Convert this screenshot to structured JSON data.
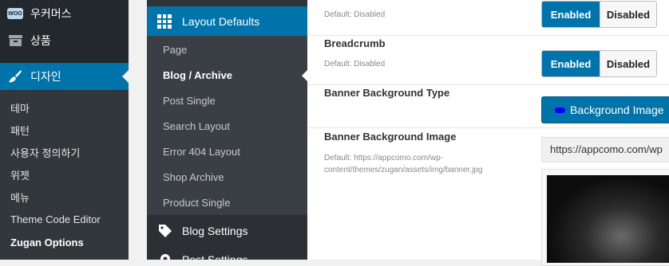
{
  "wp_sidebar": {
    "top_items": [
      {
        "label": "우커머스",
        "icon": "woo-icon",
        "badge": "WOO"
      },
      {
        "label": "상품",
        "icon": "archive-icon"
      },
      {
        "label": "디자인",
        "icon": "paintbrush-icon",
        "active": true
      }
    ],
    "sub_items": [
      {
        "label": "테마"
      },
      {
        "label": "패턴"
      },
      {
        "label": "사용자 정의하기"
      },
      {
        "label": "위젯"
      },
      {
        "label": "메뉴"
      },
      {
        "label": "Theme Code Editor"
      },
      {
        "label": "Zugan Options",
        "active": true
      }
    ]
  },
  "options_nav": {
    "section": {
      "label": "Layout Defaults",
      "icon": "grid-icon"
    },
    "items": [
      {
        "label": "Page"
      },
      {
        "label": "Blog / Archive",
        "active": true
      },
      {
        "label": "Post Single"
      },
      {
        "label": "Search Layout"
      },
      {
        "label": "Error 404 Layout"
      },
      {
        "label": "Shop Archive"
      },
      {
        "label": "Product Single"
      }
    ],
    "blog_settings": {
      "label": "Blog Settings",
      "icon": "tag-icon"
    },
    "post_settings": {
      "label": "Post Settings",
      "icon": "gear-icon"
    }
  },
  "fields": {
    "prev_toggle": {
      "desc": "Default: Disabled",
      "enabled_label": "Enabled",
      "disabled_label": "Disabled",
      "value": "Enabled"
    },
    "breadcrumb": {
      "title": "Breadcrumb",
      "desc": "Default: Disabled",
      "enabled_label": "Enabled",
      "disabled_label": "Disabled",
      "value": "Enabled"
    },
    "banner_type": {
      "title": "Banner Background Type",
      "button_label": "Background Image",
      "dot_color": "#0000ff"
    },
    "banner_image": {
      "title": "Banner Background Image",
      "desc": "Default: https://appcomo.com/wp-content/themes/zugan/assets/img/banner.jpg",
      "value": "https://appcomo.com/wp"
    }
  },
  "colors": {
    "accent": "#0073aa",
    "sidebar": "#23282d",
    "options_bg": "#383c42"
  }
}
